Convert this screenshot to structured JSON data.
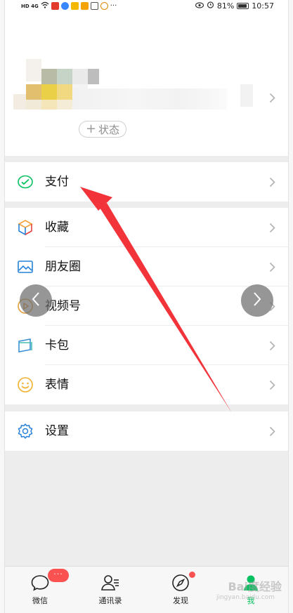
{
  "status_bar": {
    "network": "HD 4G",
    "battery": "81%",
    "battery_level": 0.81,
    "time": "10:57"
  },
  "profile": {
    "status_button": "状态",
    "status_plus": "+"
  },
  "menu_groups": [
    {
      "items": [
        {
          "label": "支付",
          "icon": "wechat-pay-icon",
          "icon_color": "#07c160"
        }
      ]
    },
    {
      "items": [
        {
          "label": "收藏",
          "icon": "favorites-cube-icon",
          "icon_color": "#f59f35"
        },
        {
          "label": "朋友圈",
          "icon": "moments-photo-icon",
          "icon_color": "#2782d7"
        },
        {
          "label": "视频号",
          "icon": "channels-play-icon",
          "icon_color": "#e0a03a"
        },
        {
          "label": "卡包",
          "icon": "card-wallet-icon",
          "icon_color": "#3b8fd6"
        },
        {
          "label": "表情",
          "icon": "sticker-smile-icon",
          "icon_color": "#f0b12b"
        }
      ]
    },
    {
      "items": [
        {
          "label": "设置",
          "icon": "settings-gear-icon",
          "icon_color": "#2782d7"
        }
      ]
    }
  ],
  "tabbar": {
    "tabs": [
      {
        "label": "微信",
        "icon": "chat-bubble-icon",
        "badge": "···"
      },
      {
        "label": "通讯录",
        "icon": "contacts-icon"
      },
      {
        "label": "发现",
        "icon": "compass-icon"
      },
      {
        "label": "我",
        "icon": "me-person-icon"
      }
    ],
    "active_color": "#07c160"
  },
  "watermark": {
    "brand": "Bai度经验",
    "url": "jingyan.baidu.com"
  },
  "colors": {
    "accent_green": "#07c160",
    "badge_red": "#fa5151",
    "annotation_arrow": "#f2333a"
  }
}
